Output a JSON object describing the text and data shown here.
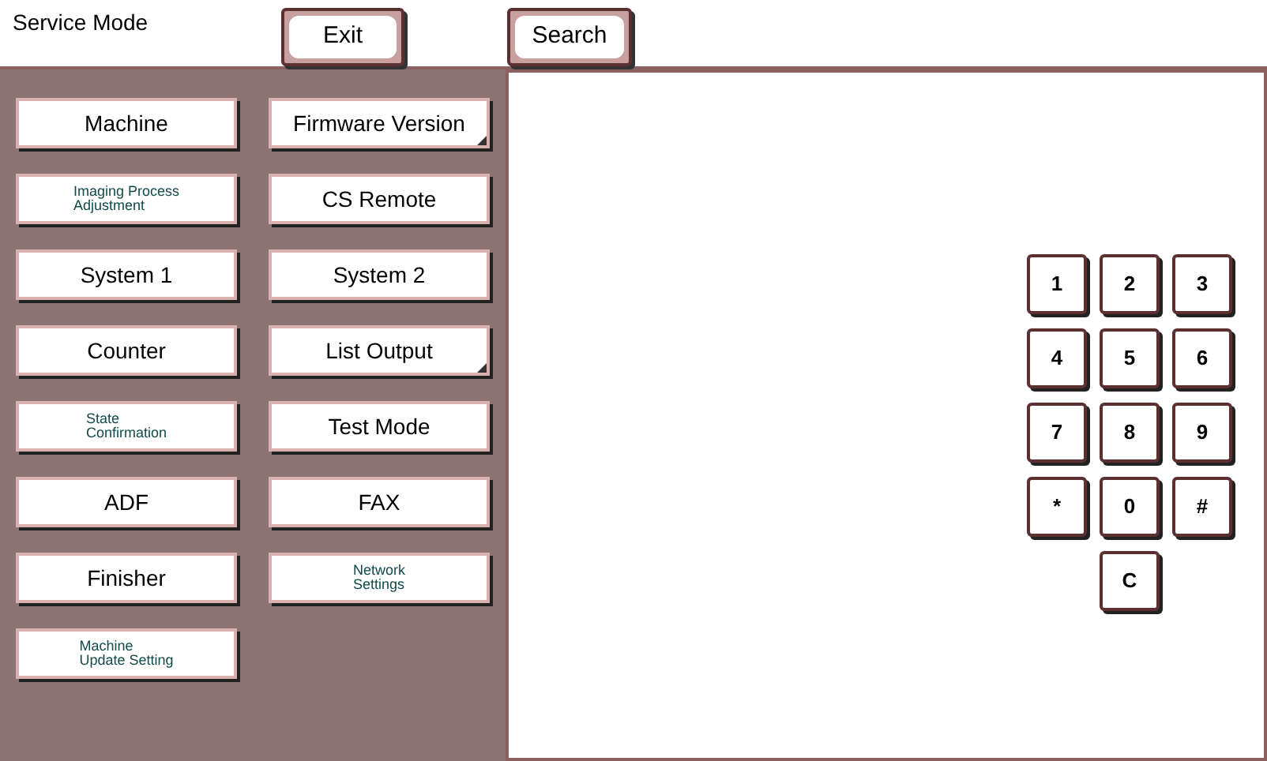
{
  "header": {
    "title": "Service Mode",
    "buttons": [
      "Exit",
      "Search"
    ]
  },
  "menu": [
    {
      "label": "Machine",
      "kind": "normal",
      "corner_mark": false
    },
    {
      "label": "Firmware Version",
      "kind": "normal",
      "corner_mark": true
    },
    {
      "label": "Imaging Process\nAdjustment",
      "kind": "small",
      "corner_mark": false
    },
    {
      "label": "CS Remote",
      "kind": "normal",
      "corner_mark": false
    },
    {
      "label": "System 1",
      "kind": "normal",
      "corner_mark": false
    },
    {
      "label": "System 2",
      "kind": "normal",
      "corner_mark": false
    },
    {
      "label": "Counter",
      "kind": "normal",
      "corner_mark": false
    },
    {
      "label": "List Output",
      "kind": "normal",
      "corner_mark": true
    },
    {
      "label": "State\nConfirmation",
      "kind": "small",
      "corner_mark": false
    },
    {
      "label": "Test Mode",
      "kind": "normal",
      "corner_mark": false
    },
    {
      "label": "ADF",
      "kind": "normal",
      "corner_mark": false
    },
    {
      "label": "FAX",
      "kind": "normal",
      "corner_mark": false
    },
    {
      "label": "Finisher",
      "kind": "normal",
      "corner_mark": false
    },
    {
      "label": "Network\nSettings",
      "kind": "small",
      "corner_mark": false
    },
    {
      "label": "Machine\nUpdate Setting",
      "kind": "small",
      "corner_mark": false
    }
  ],
  "keypad": [
    [
      "1",
      "2",
      "3"
    ],
    [
      "4",
      "5",
      "6"
    ],
    [
      "7",
      "8",
      "9"
    ],
    [
      "*",
      "0",
      "#"
    ],
    [
      "C"
    ]
  ]
}
